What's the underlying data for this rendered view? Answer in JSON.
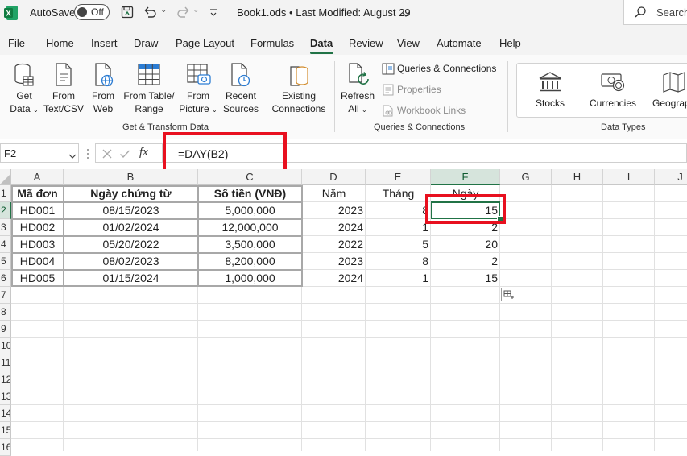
{
  "titlebar": {
    "autosave_label": "AutoSave",
    "autosave_state": "Off",
    "document_title": "Book1.ods • Last Modified: August 29",
    "search_placeholder": "Search"
  },
  "menu": {
    "items": [
      "File",
      "Home",
      "Insert",
      "Draw",
      "Page Layout",
      "Formulas",
      "Data",
      "Review",
      "View",
      "Automate",
      "Help"
    ],
    "active": "Data"
  },
  "ribbon": {
    "get_transform": {
      "get_data": [
        "Get",
        "Data"
      ],
      "from_text": [
        "From",
        "Text/CSV"
      ],
      "from_web": [
        "From",
        "Web"
      ],
      "from_table": [
        "From Table/",
        "Range"
      ],
      "from_picture": [
        "From",
        "Picture"
      ],
      "recent_sources": [
        "Recent",
        "Sources"
      ],
      "existing_connections": [
        "Existing",
        "Connections"
      ],
      "group_label": "Get & Transform Data"
    },
    "queries": {
      "refresh_all": [
        "Refresh",
        "All"
      ],
      "queries_connections": "Queries & Connections",
      "properties": "Properties",
      "workbook_links": "Workbook Links",
      "group_label": "Queries & Connections"
    },
    "data_types": {
      "stocks": "Stocks",
      "currencies": "Currencies",
      "geography": "Geography",
      "group_label": "Data Types"
    }
  },
  "formula_bar": {
    "name_box": "F2",
    "fx": "fx",
    "formula": "=DAY(B2)"
  },
  "grid": {
    "columns": [
      "A",
      "B",
      "C",
      "D",
      "E",
      "F",
      "G",
      "H",
      "I",
      "J"
    ],
    "rows": [
      "1",
      "2",
      "3",
      "4",
      "5",
      "6",
      "7",
      "8",
      "9",
      "10",
      "11",
      "12",
      "13",
      "14",
      "15",
      "16"
    ],
    "headers": [
      "Mã đơn",
      "Ngày chứng từ",
      "Số tiền (VNĐ)",
      "Năm",
      "Tháng",
      "Ngày"
    ],
    "data": [
      [
        "HD001",
        "08/15/2023",
        "5,000,000",
        "2023",
        "8",
        "15"
      ],
      [
        "HD002",
        "01/02/2024",
        "12,000,000",
        "2024",
        "1",
        "2"
      ],
      [
        "HD003",
        "05/20/2022",
        "3,500,000",
        "2022",
        "5",
        "20"
      ],
      [
        "HD004",
        "08/02/2023",
        "8,200,000",
        "2023",
        "8",
        "2"
      ],
      [
        "HD005",
        "01/15/2024",
        "1,000,000",
        "2024",
        "1",
        "15"
      ]
    ],
    "active_cell": "F2"
  },
  "colors": {
    "excel_green": "#217346",
    "highlight_red": "#e8101f"
  }
}
